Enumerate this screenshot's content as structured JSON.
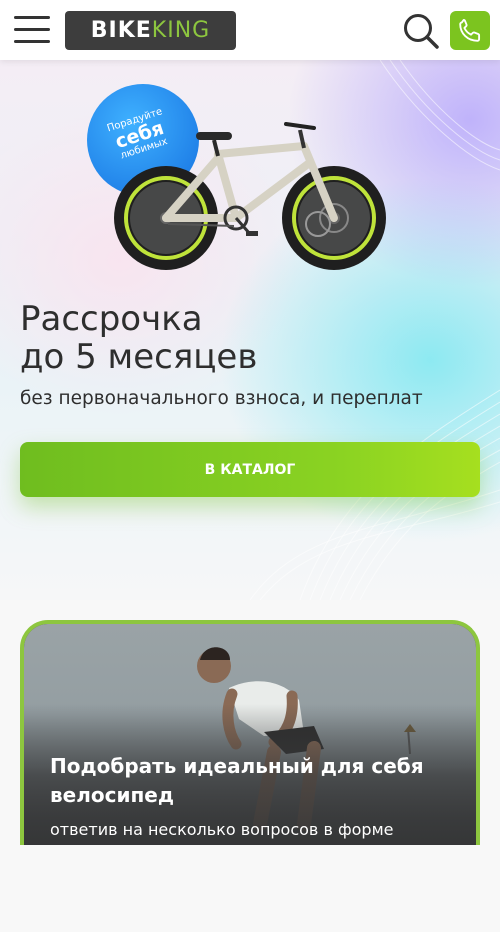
{
  "header": {
    "logo": {
      "part1": "BIKE",
      "part2": "KING"
    },
    "menu_icon": "hamburger-menu-icon",
    "search_icon": "search-icon",
    "phone_icon": "phone-icon",
    "accent_color": "#7cc41f"
  },
  "hero": {
    "badge": {
      "line1": "Порадуйте",
      "line2": "себя",
      "line3": "любимых"
    },
    "title_line1": "Рассрочка",
    "title_line2": "до 5 месяцев",
    "subtitle": "без первоначального взноса, и переплат",
    "button_label": "В КАТАЛОГ"
  },
  "promo_card": {
    "title": "Подобрать идеальный для себя велосипед",
    "subtitle": "ответив на несколько вопросов в форме"
  }
}
